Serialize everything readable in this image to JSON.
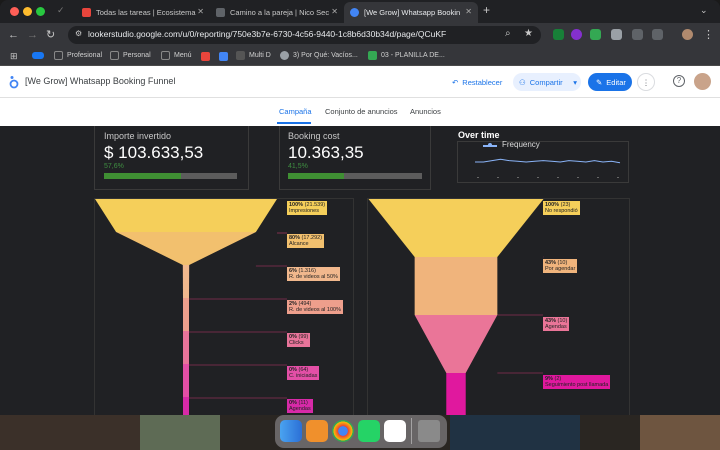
{
  "browser": {
    "tabs": [
      {
        "label": "Todas las tareas | Ecosistema",
        "favicon_color": "#e8453c",
        "active": false
      },
      {
        "label": "Camino a la pareja | Nico Sec",
        "favicon_color": "#5f6368",
        "active": false
      },
      {
        "label": "[We Grow] Whatsapp Bookin",
        "favicon_color": "#4285f4",
        "active": true
      }
    ],
    "new_tab_glyph": "+",
    "url": "lookerstudio.google.com/u/0/reporting/750e3b7e-6730-4c56-9440-1c8b6d30b34d/page/QCuKF",
    "bookmarks": [
      "Profesional",
      "Personal",
      "Menú",
      "Multi D",
      "3) Por Qué: Vacíos...",
      "03 - PLANILLA DE..."
    ]
  },
  "looker": {
    "report_title": "[We Grow] Whatsapp Booking Funnel",
    "reset_label": "Restablecer",
    "share_label": "Compartir",
    "edit_label": "Editar",
    "page_tabs": [
      "Campaña",
      "Conjunto de anuncios",
      "Anuncios"
    ],
    "active_tab": "Campaña"
  },
  "scorecards": [
    {
      "label": "Importe invertido",
      "value": "$ 103.633,53",
      "percent_text": "57,6%",
      "progress": 0.576
    },
    {
      "label": "Booking cost",
      "value": "10.363,35",
      "percent_text": "41,5%",
      "progress": 0.415
    }
  ],
  "over_time": {
    "title": "Over time",
    "legend": "Frequency"
  },
  "chart_data": [
    {
      "type": "funnel",
      "title": "",
      "stages": [
        {
          "pct": "100%",
          "count": "(21.539)",
          "label": "Impresiones",
          "value": 21539,
          "color": "#f5cf5a"
        },
        {
          "pct": "80%",
          "count": "(17.292)",
          "label": "Alcance",
          "value": 17292,
          "color": "#f2c06e"
        },
        {
          "pct": "6%",
          "count": "(1.316)",
          "label": "R. de videos al 50%",
          "value": 1316,
          "color": "#f1b88d"
        },
        {
          "pct": "2%",
          "count": "(494)",
          "label": "R. de videos al 100%",
          "value": 494,
          "color": "#ee9f8c"
        },
        {
          "pct": "0%",
          "count": "(99)",
          "label": "Clicks",
          "value": 99,
          "color": "#e8749a"
        },
        {
          "pct": "0%",
          "count": "(64)",
          "label": "C. iniciadas",
          "value": 64,
          "color": "#e34fa6"
        },
        {
          "pct": "0%",
          "count": "(11)",
          "label": "Agendas",
          "value": 11,
          "color": "#d72aa8"
        }
      ]
    },
    {
      "type": "funnel",
      "title": "",
      "stages": [
        {
          "pct": "100%",
          "count": "(23)",
          "label": "No respondió",
          "value": 23,
          "color": "#f5cf5a"
        },
        {
          "pct": "43%",
          "count": "(10)",
          "label": "Por agendar",
          "value": 10,
          "color": "#f0b47c"
        },
        {
          "pct": "43%",
          "count": "(10)",
          "label": "Agendas",
          "value": 10,
          "color": "#ea7598"
        },
        {
          "pct": "9%",
          "count": "(2)",
          "label": "Seguimiento post llamada",
          "value": 2,
          "color": "#e0189e"
        }
      ]
    },
    {
      "type": "line",
      "title": "Over time",
      "series": [
        {
          "name": "Frequency",
          "values": [
            1.0,
            1.0,
            1.1,
            1.2,
            1.1,
            1.05,
            1.0,
            1.05,
            1.1,
            1.05,
            1.0,
            1.1,
            1.05,
            1.0,
            1.1,
            1.0,
            1.05,
            0.95
          ]
        }
      ],
      "ylim": [
        0,
        2.0
      ]
    }
  ],
  "dock": [
    "Finder",
    "Books",
    "Chrome",
    "WhatsApp",
    "Todoist",
    "Trash"
  ]
}
